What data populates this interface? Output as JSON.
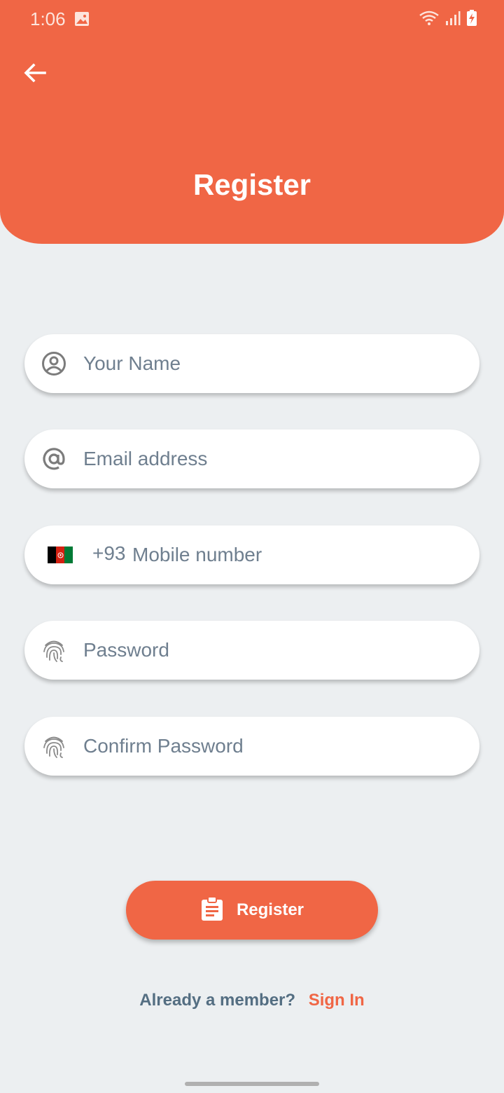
{
  "status_bar": {
    "time": "1:06",
    "icons": [
      "gallery-icon",
      "wifi-icon",
      "signal-icon",
      "battery-charging-icon"
    ]
  },
  "header": {
    "title": "Register",
    "back_icon": "arrow-left-icon",
    "background_color": "#f06645"
  },
  "form": {
    "name": {
      "placeholder": "Your Name",
      "icon": "account-circle-icon",
      "value": ""
    },
    "email": {
      "placeholder": "Email address",
      "icon": "at-sign-icon",
      "value": ""
    },
    "phone": {
      "country_flag": "afghanistan-flag-icon",
      "dial_code": "+93",
      "placeholder": "Mobile number",
      "value": ""
    },
    "password": {
      "placeholder": "Password",
      "icon": "fingerprint-icon",
      "value": ""
    },
    "confirm_password": {
      "placeholder": "Confirm Password",
      "icon": "fingerprint-icon",
      "value": ""
    }
  },
  "register_button": {
    "label": "Register",
    "icon": "clipboard-icon"
  },
  "footer": {
    "question": "Already a member?",
    "sign_in_label": "Sign In"
  },
  "colors": {
    "accent": "#f06645",
    "background": "#eceff1",
    "placeholder": "#6f7f8f"
  }
}
